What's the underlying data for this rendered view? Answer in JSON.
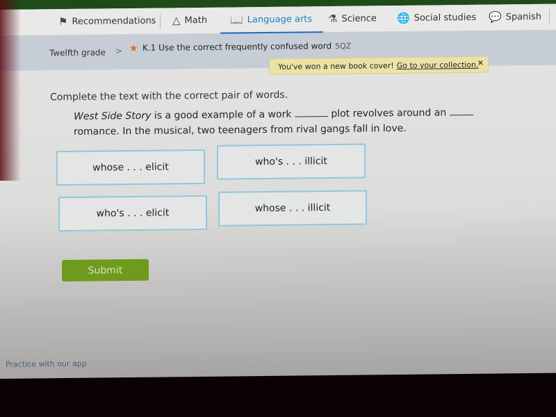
{
  "nav": {
    "items": [
      {
        "label": "Recommendations",
        "icon": "signpost-icon",
        "glyph": "⚑",
        "active": false
      },
      {
        "label": "Math",
        "icon": "pyramid-icon",
        "glyph": "△",
        "active": false
      },
      {
        "label": "Language arts",
        "icon": "book-icon",
        "glyph": "📖",
        "active": true
      },
      {
        "label": "Science",
        "icon": "flask-icon",
        "glyph": "⚗",
        "active": false
      },
      {
        "label": "Social studies",
        "icon": "globe-icon",
        "glyph": "🌐",
        "active": false
      },
      {
        "label": "Spanish",
        "icon": "speech-bubbles-icon",
        "glyph": "💬",
        "active": false
      }
    ]
  },
  "breadcrumb": {
    "grade": "Twelfth grade",
    "separator": ">",
    "skill_title": "K.1 Use the correct frequently confused word",
    "skill_code": "5QZ"
  },
  "toast": {
    "message": "You've won a new book cover!",
    "link": "Go to your collection.",
    "close": "×"
  },
  "question": {
    "instruction": "Complete the text with the correct pair of words.",
    "title_italic": "West Side Story",
    "part1": " is a good example of a work ",
    "part2": " plot revolves around an ",
    "part3": " romance. In the musical, two teenagers from rival gangs fall in love."
  },
  "choices": [
    "whose . . . elicit",
    "who's . . . illicit",
    "who's . . . elicit",
    "whose . . . illicit"
  ],
  "submit_label": "Submit",
  "footer": {
    "app_link": "Practice with our app"
  },
  "colors": {
    "accent_blue": "#1a7fc8",
    "submit_green": "#6e9a1e",
    "choice_border": "#8fc8dc",
    "toast_bg": "#ece2a6",
    "star_orange": "#e8641a"
  }
}
